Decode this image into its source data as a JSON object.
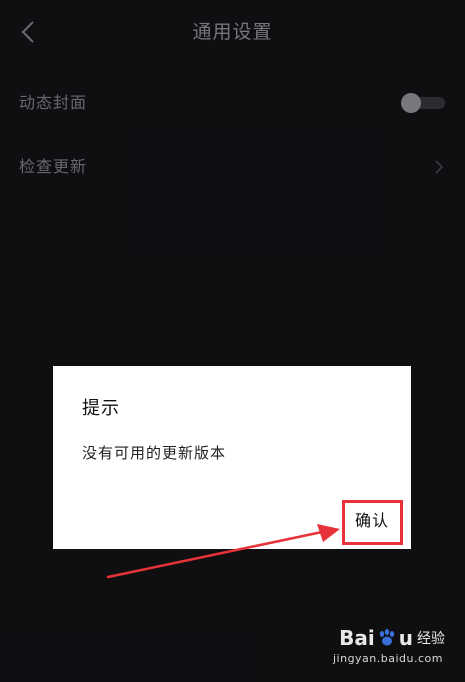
{
  "header": {
    "title": "通用设置"
  },
  "settings": {
    "items": [
      {
        "label": "动态封面",
        "toggle_on": false
      },
      {
        "label": "检查更新"
      }
    ]
  },
  "dialog": {
    "title": "提示",
    "message": "没有可用的更新版本",
    "confirm_label": "确认"
  },
  "annotation": {
    "highlight_color": "#e8323a"
  },
  "watermark": {
    "brand_left": "Bai",
    "brand_right": "u",
    "product": "经验",
    "url": "jingyan.baidu.com"
  },
  "colors": {
    "background": "#101014",
    "dialog_background": "#ffffff",
    "text_dim": "#6d6d76"
  }
}
